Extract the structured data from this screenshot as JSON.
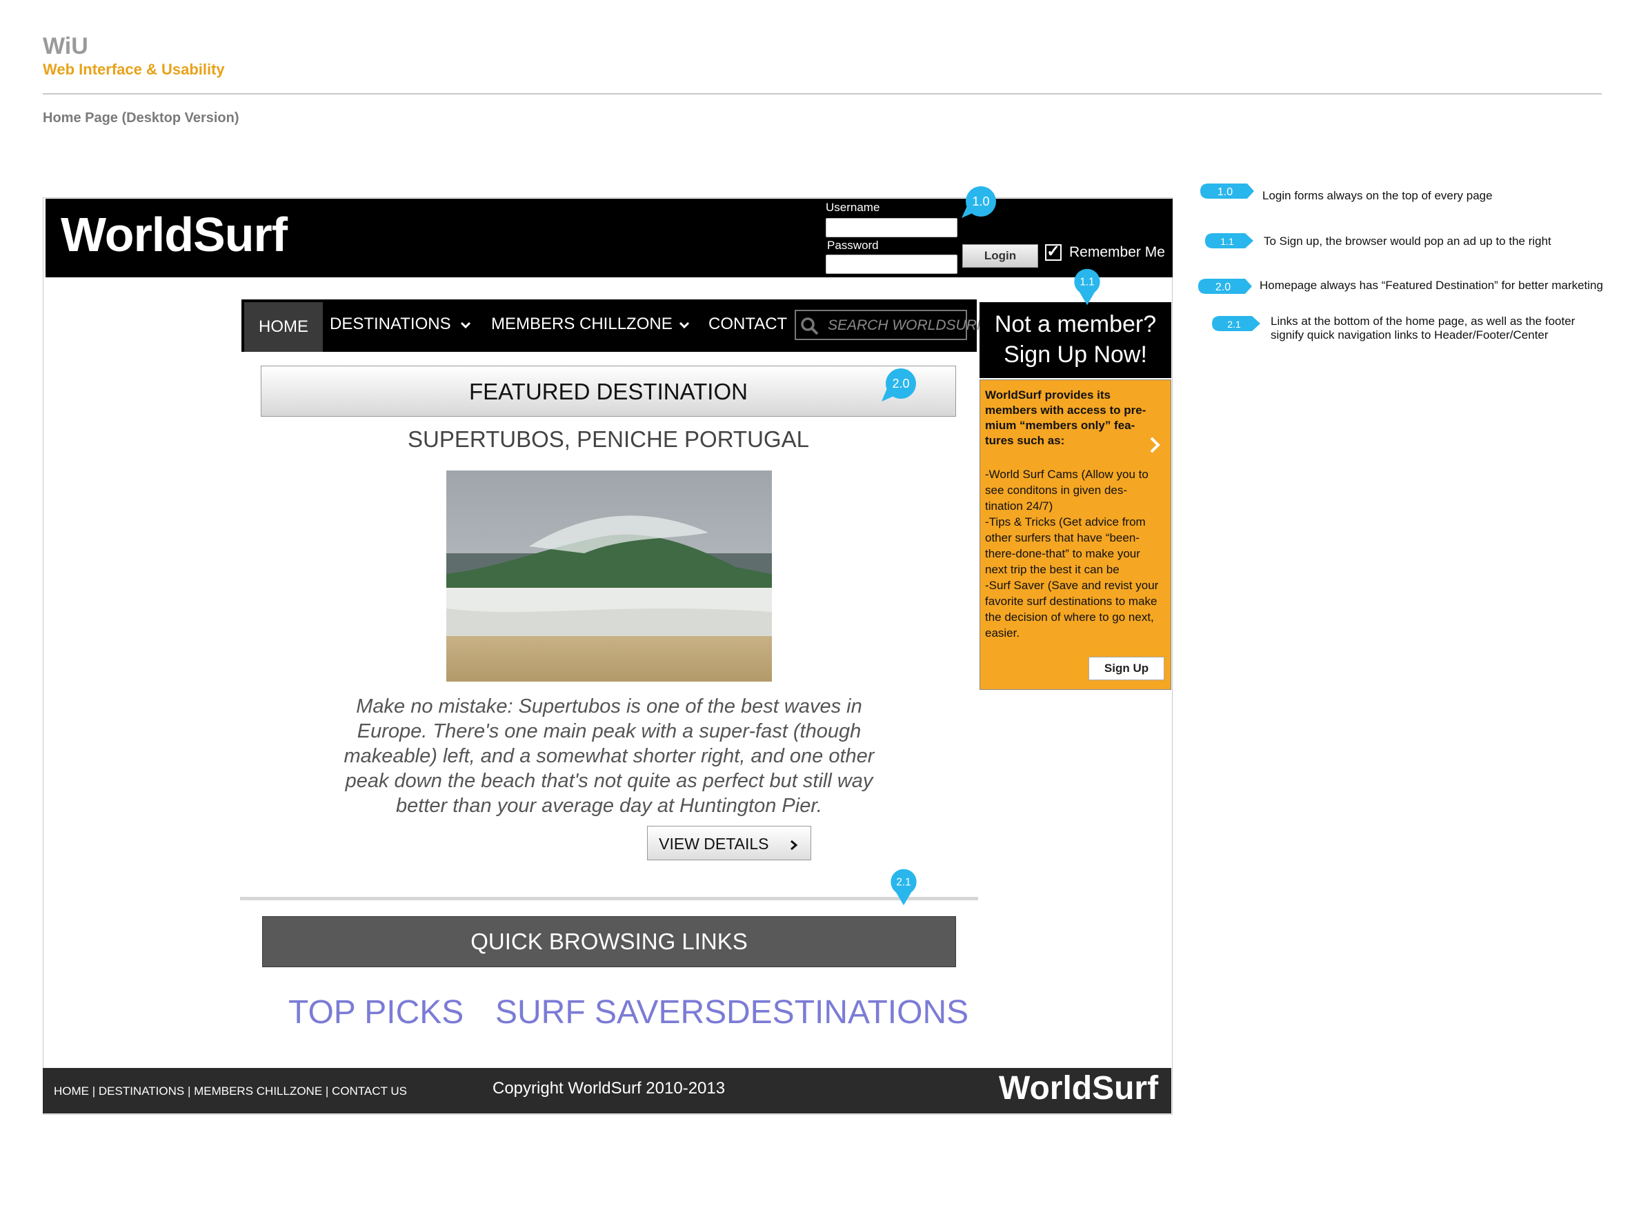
{
  "doc": {
    "brand": "WiU",
    "subtitle": "Web Interface & Usability",
    "page_title": "Home Page (Desktop Version)"
  },
  "header": {
    "logo": "WorldSurf",
    "username_label": "Username",
    "password_label": "Password",
    "username_value": "",
    "password_value": "",
    "login_button": "Login",
    "remember_label": "Remember Me",
    "remember_checked": true
  },
  "nav": {
    "items": [
      {
        "label": "HOME",
        "active": true
      },
      {
        "label": "DESTINATIONS",
        "dropdown": true
      },
      {
        "label": "MEMBERS CHILLZONE",
        "dropdown": true
      },
      {
        "label": "CONTACT"
      }
    ],
    "search_placeholder": "SEARCH WORLDSURF"
  },
  "featured": {
    "bar_label": "FEATURED DESTINATION",
    "title": "SUPERTUBOS, PENICHE PORTUGAL",
    "description": "Make no mistake: Supertubos is one of the best waves in Europe. There's one main peak with a super-fast (though makeable) left, and a somewhat shorter right, and one other peak down the beach that's not quite as perfect but still way better than your average day at Huntington Pier.",
    "button": "VIEW DETAILS"
  },
  "quick": {
    "bar_label": "QUICK BROWSING LINKS",
    "links": [
      "TOP PICKS",
      "SURF SAVERS",
      "DESTINATIONS"
    ]
  },
  "sidebar": {
    "heading_line1": "Not a member?",
    "heading_line2": "Sign Up Now!",
    "intro": "WorldSurf provides its members with access to pre-mium “members only” fea-tures such as:",
    "features": [
      "-World Surf Cams (Allow you to see conditons in given des-tination 24/7)",
      "-Tips & Tricks (Get advice from other surfers that have “been-there-done-that” to make your next trip the best it can be",
      "-Surf Saver (Save and revist your favorite surf destinations to make the decision of where to go next, easier."
    ],
    "button": "Sign Up"
  },
  "footer": {
    "links": "HOME | DESTINATIONS | MEMBERS CHILLZONE | CONTACT US",
    "copyright": "Copyright WorldSurf 2010-2013",
    "logo": "WorldSurf"
  },
  "markers": {
    "m10": "1.0",
    "m11": "1.1",
    "m20": "2.0",
    "m21": "2.1"
  },
  "annotations": [
    {
      "tag": "1.0",
      "text": "Login forms always on the top of every page"
    },
    {
      "tag": "1.1",
      "text": "To Sign up, the browser would pop an ad up to the right"
    },
    {
      "tag": "2.0",
      "text": "Homepage always has “Featured Destination” for better marketing"
    },
    {
      "tag": "2.1",
      "text": "Links at the bottom of the home page, as well as the footer signify quick navigation links to Header/Footer/Center"
    }
  ],
  "colors": {
    "accent_yellow": "#e8a21a",
    "sidebar_orange": "#f5a623",
    "marker_blue": "#29b6ec",
    "quick_link": "#7b7bd6"
  },
  "icons": {
    "search": "search-icon",
    "chevron": "chevron-down-icon",
    "check": "checkbox-check-icon"
  }
}
